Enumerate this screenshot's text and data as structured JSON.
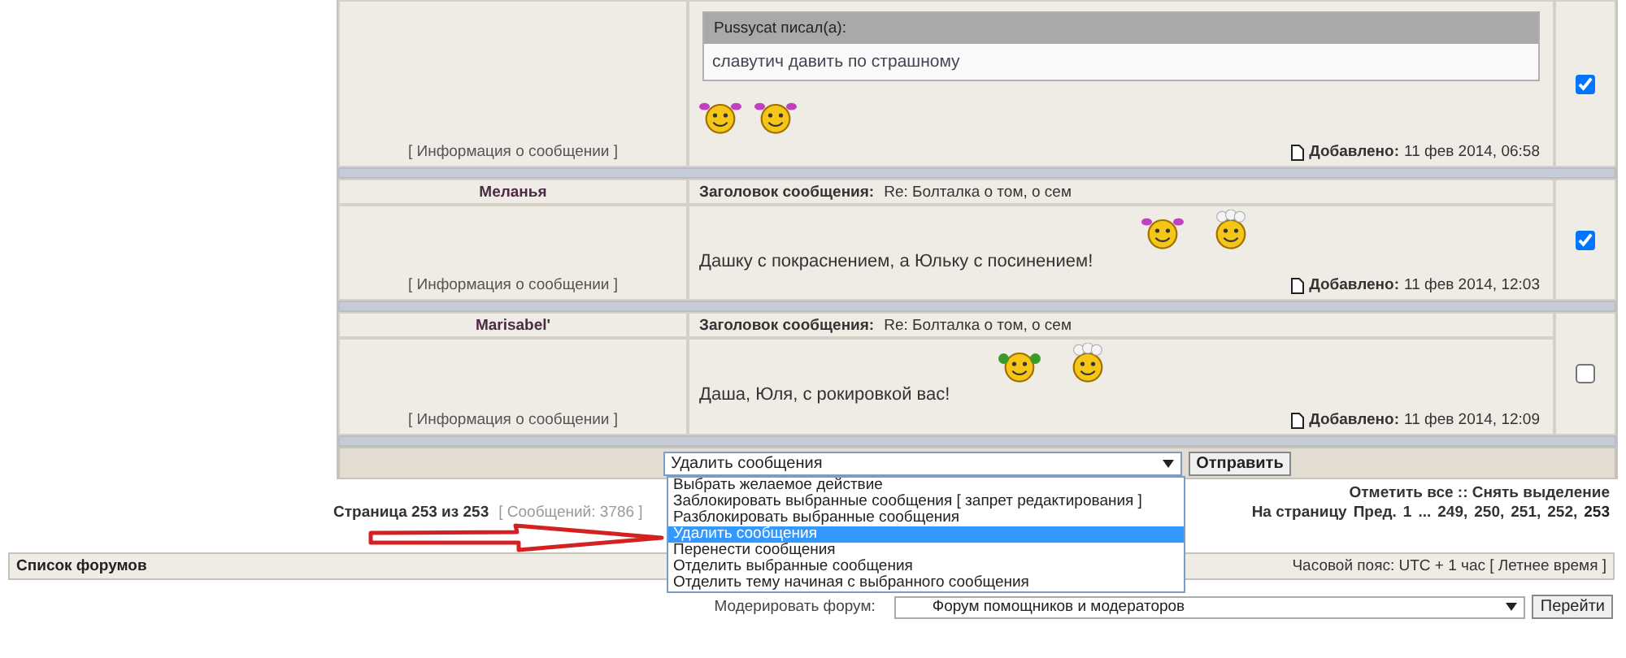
{
  "posts": [
    {
      "quote": {
        "author": "Pussycat писал(а):",
        "text": "славутич давить по страшному"
      },
      "emoticons": [
        {
          "kind": "pigtails"
        },
        {
          "kind": "pigtails"
        }
      ],
      "info_link": "[ Информация о сообщении ]",
      "posted_label": "Добавлено:",
      "posted": "11 фев 2014, 06:58",
      "selected": true
    },
    {
      "author": "Меланья",
      "subject_label": "Заголовок сообщения:",
      "subject": "Re: Болталка о том, о сем",
      "message": "Дашку с покраснением, а Юльку с посинением!",
      "emoticons": [
        {
          "kind": "pigtails"
        },
        {
          "kind": "flowers"
        }
      ],
      "info_link": "[ Информация о сообщении ]",
      "posted_label": "Добавлено:",
      "posted": "11 фев 2014, 12:03",
      "selected": true
    },
    {
      "author": "Marisabel'",
      "subject_label": "Заголовок сообщения:",
      "subject": "Re: Болталка о том, о сем",
      "message": "Даша, Юля, с рокировкой вас!",
      "emoticons": [
        {
          "kind": "clover"
        },
        {
          "kind": "flowers"
        }
      ],
      "info_link": "[ Информация о сообщении ]",
      "posted_label": "Добавлено:",
      "posted": "11 фев 2014, 12:09",
      "selected": false
    }
  ],
  "moderation": {
    "value": "Удалить сообщения",
    "expanded": true,
    "options": [
      {
        "label": "Выбрать желаемое действие",
        "selected": false
      },
      {
        "label": "Заблокировать выбранные сообщения [ запрет редактирования ]",
        "selected": false
      },
      {
        "label": "Разблокировать выбранные сообщения",
        "selected": false
      },
      {
        "label": "Удалить сообщения",
        "selected": true
      },
      {
        "label": "Перенести сообщения",
        "selected": false
      },
      {
        "label": "Отделить выбранные сообщения",
        "selected": false
      },
      {
        "label": "Отделить тему начиная с выбранного сообщения",
        "selected": false
      }
    ],
    "submit": "Отправить"
  },
  "mark_links": {
    "mark_all": "Отметить все",
    "separator": "::",
    "unmark_all": "Снять выделение"
  },
  "pagination": {
    "page_of": "Страница 253 из 253",
    "post_count": "[ Сообщений: 3786 ]",
    "label": "На страницу",
    "pages": [
      {
        "text": "Пред.",
        "kind": "link"
      },
      {
        "text": "1",
        "kind": "link"
      },
      {
        "text": "...",
        "kind": "gap"
      },
      {
        "text": "249,",
        "kind": "link"
      },
      {
        "text": "250,",
        "kind": "link"
      },
      {
        "text": "251,",
        "kind": "link"
      },
      {
        "text": "252,",
        "kind": "link"
      },
      {
        "text": "253",
        "kind": "current"
      }
    ]
  },
  "forum_bar": {
    "title": "Список форумов",
    "timezone": "Часовой пояс: UTC + 1 час [ Летнее время ]"
  },
  "moderate_forum": {
    "label": "Модерировать форум:",
    "value": "Форум помощников и модераторов",
    "button": "Перейти"
  }
}
